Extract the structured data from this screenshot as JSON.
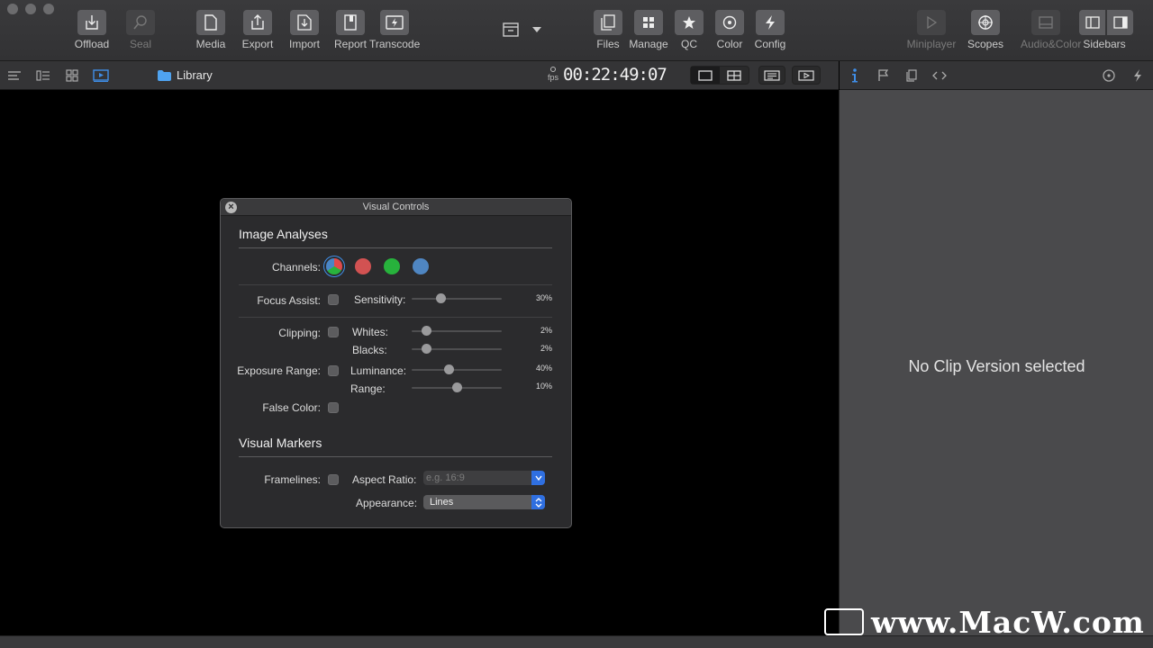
{
  "toolbar": {
    "left_buttons": [
      {
        "label": "Offload",
        "icon": "offload-icon"
      },
      {
        "label": "Seal",
        "icon": "seal-icon"
      },
      {
        "label": "Media",
        "icon": "media-icon"
      },
      {
        "label": "Export",
        "icon": "export-icon"
      },
      {
        "label": "Import",
        "icon": "import-icon"
      },
      {
        "label": "Report",
        "icon": "report-icon"
      },
      {
        "label": "Transcode",
        "icon": "transcode-icon"
      }
    ],
    "center_buttons": [
      {
        "label": "Files",
        "icon": "files-icon"
      },
      {
        "label": "Manage",
        "icon": "manage-icon"
      },
      {
        "label": "QC",
        "icon": "star-icon"
      },
      {
        "label": "Color",
        "icon": "color-icon"
      },
      {
        "label": "Config",
        "icon": "bolt-icon"
      }
    ],
    "right_buttons": [
      {
        "label": "Miniplayer",
        "icon": "play-icon"
      },
      {
        "label": "Scopes",
        "icon": "scopes-icon"
      },
      {
        "label": "Audio&Color",
        "icon": "audio-color-icon"
      },
      {
        "label": "Sidebars",
        "icon": "sidebars-icon"
      }
    ]
  },
  "subbar": {
    "library_label": "Library",
    "fps_label": "fps",
    "timecode": "00:22:49:07"
  },
  "sidebar": {
    "empty_message": "No Clip Version selected"
  },
  "panel": {
    "title": "Visual Controls",
    "image_analyses": {
      "heading": "Image Analyses",
      "channels_label": "Channels:",
      "channel_colors": [
        "#e04848",
        "#d25252",
        "#27b23c",
        "#4f86c2"
      ],
      "focus_assist_label": "Focus Assist:",
      "sensitivity_label": "Sensitivity:",
      "sensitivity_value": "30%",
      "sensitivity_fraction": 0.3,
      "clipping_label": "Clipping:",
      "whites_label": "Whites:",
      "whites_value": "2%",
      "whites_fraction": 0.02,
      "blacks_label": "Blacks:",
      "blacks_value": "2%",
      "blacks_fraction": 0.02,
      "exposure_range_label": "Exposure Range:",
      "luminance_label": "Luminance:",
      "luminance_value": "40%",
      "luminance_fraction": 0.4,
      "range_label": "Range:",
      "range_value": "10%",
      "range_fraction": 0.1,
      "false_color_label": "False Color:"
    },
    "visual_markers": {
      "heading": "Visual Markers",
      "framelines_label": "Framelines:",
      "aspect_ratio_label": "Aspect Ratio:",
      "aspect_ratio_placeholder": "e.g. 16:9",
      "appearance_label": "Appearance:",
      "appearance_value": "Lines"
    }
  },
  "watermark": {
    "text": "www.MacW.com"
  }
}
